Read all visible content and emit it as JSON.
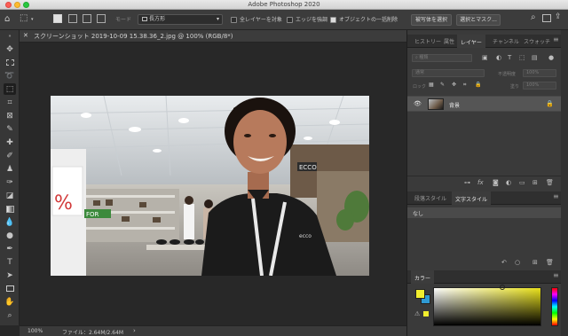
{
  "window": {
    "title": "Adobe Photoshop 2020"
  },
  "options": {
    "mode_label": "モード",
    "shape_mode": "長方形",
    "all_layers": "全レイヤーを対象",
    "enhance_edge": "エッジを強調",
    "object_subtract": "オブジェクトの一括削除",
    "select_subject": "被写体を選択",
    "select_mask": "選択とマスク..."
  },
  "document": {
    "tab_title": "スクリーンショット 2019-10-09 15.38.36_2.jpg @ 100% (RGB/8*)",
    "zoom": "100%",
    "file_info": "ファイル：2.64M/2.64M",
    "photo_sign_text": "%",
    "photo_sign_sub": "FOR",
    "photo_shop_text": "ECCO",
    "photo_shirt_logo": "ecco"
  },
  "layers_panel": {
    "tabs": [
      "ヒストリー",
      "属性",
      "レイヤー",
      "チャンネル",
      "スウォッチ"
    ],
    "filter_kind": "種類",
    "blend_mode": "通常",
    "opacity_label": "不透明度",
    "opacity_value": "100%",
    "lock_label": "ロック",
    "fill_label": "塗り",
    "fill_value": "100%",
    "layer_name": "背景"
  },
  "style_panel": {
    "tabs": [
      "段落スタイル",
      "文字スタイル"
    ],
    "item": "なし"
  },
  "color_panel": {
    "tab": "カラー",
    "foreground": "#f2ee2e",
    "background": "#2f9ad4",
    "field_hue": "#e8e01a"
  }
}
